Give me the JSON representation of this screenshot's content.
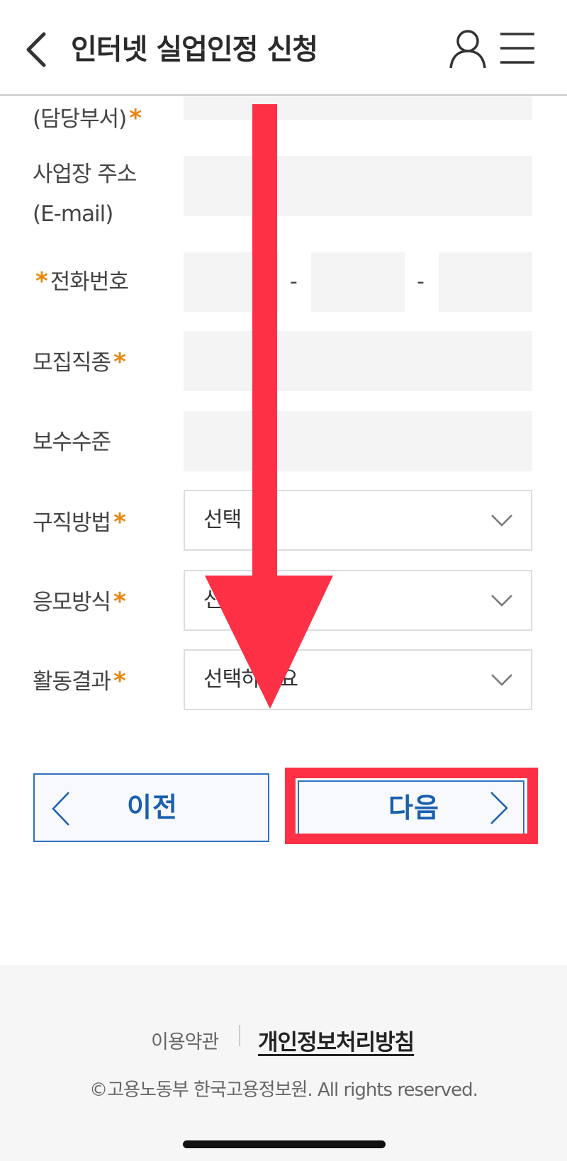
{
  "header": {
    "title": "인터넷 실업인정 신청",
    "back_icon": "chevron-left-icon",
    "user_icon": "user-icon",
    "menu_icon": "hamburger-menu-icon"
  },
  "form": {
    "department_label": "(담당부서)",
    "address_label_line1": "사업장 주소",
    "address_label_line2": "(E-mail)",
    "phone_label": "전화번호",
    "phone_separator": "-",
    "job_type_label": "모집직종",
    "salary_label": "보수수준",
    "method_label": "구직방법",
    "method_value": "선택",
    "apply_label": "응모방식",
    "apply_value": "선택하세요",
    "result_label": "활동결과",
    "result_value": "선택하세요",
    "required_mark": "*"
  },
  "nav": {
    "prev_label": "이전",
    "next_label": "다음"
  },
  "footer": {
    "terms": "이용약관",
    "privacy": "개인정보처리방침",
    "copyright": "©고용노동부 한국고용정보원. All rights reserved."
  },
  "colors": {
    "accent_blue": "#1a5fb0",
    "required_orange": "#e8860f",
    "annotation_red": "#fd3045"
  }
}
